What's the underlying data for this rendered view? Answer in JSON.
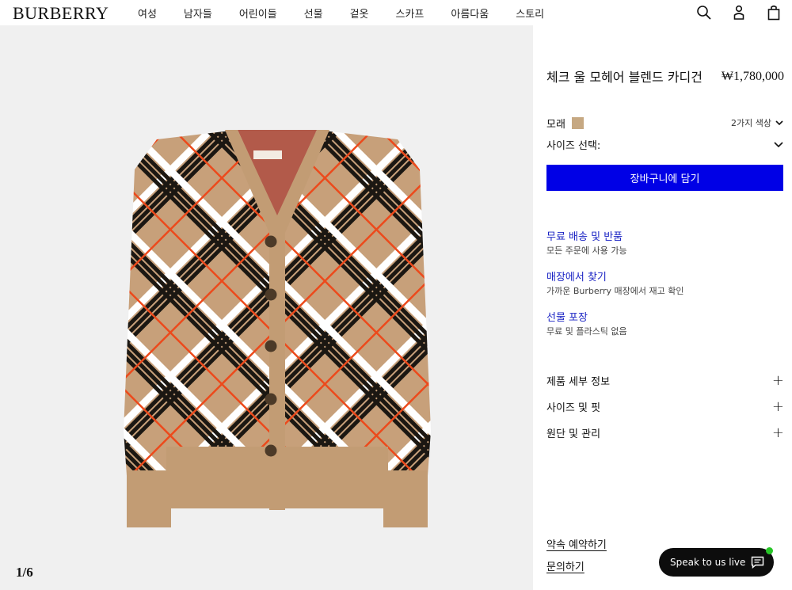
{
  "brand": {
    "logo": "BURBERRY"
  },
  "nav": {
    "items": [
      "여성",
      "남자들",
      "어린이들",
      "선물",
      "겉옷",
      "스카프",
      "아름다움",
      "스토리"
    ]
  },
  "header_icons": [
    "search-icon",
    "user-icon",
    "bag-icon"
  ],
  "gallery": {
    "counter": "1/6"
  },
  "product": {
    "title": "체크 울 모헤어 블렌드 카디건",
    "price": "₩1,780,000",
    "color_name": "모래",
    "swatch_color": "#c6a882",
    "color_count": "2가지 색상",
    "size_label": "사이즈 선택:",
    "cart_button": "장바구니에 담기",
    "cart_button_color": "#0000e6"
  },
  "services": [
    {
      "title": "무료 배송 및 반품",
      "desc": "모든 주문에 사용 가능"
    },
    {
      "title": "매장에서 찾기",
      "desc": "가까운 Burberry 매장에서 재고 확인"
    },
    {
      "title": "선물 포장",
      "desc": "무료 및 플라스틱 없음"
    }
  ],
  "accordion": [
    "제품 세부 정보",
    "사이즈 및 핏",
    "원단 및 관리"
  ],
  "footer_links": [
    "약속 예약하기",
    "문의하기"
  ],
  "chat": {
    "label": "Speak to us live",
    "status_color": "#27c527"
  }
}
